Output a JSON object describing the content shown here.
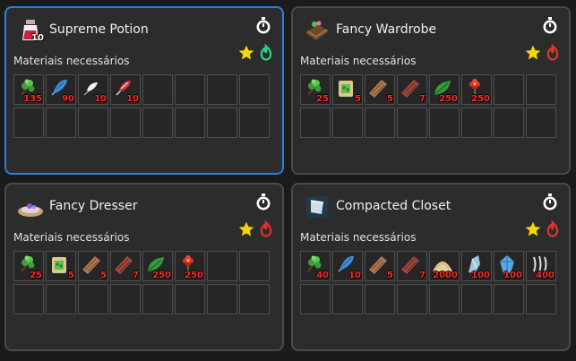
{
  "colors": {
    "selected_border": "#2b7fe0",
    "card_bg": "#2c2c2c",
    "quantity": "#ff2a2a",
    "star": "#f5d50a",
    "flame_red": "#e2332a",
    "flame_green": "#2bd38a"
  },
  "cards": [
    {
      "title": "Supreme Potion",
      "subtitle": "Materiais necessários",
      "icon": "potion-icon",
      "icon_badge": "10",
      "flame": "green",
      "selected": true,
      "materials": [
        {
          "icon": "herb-icon",
          "qty": "135"
        },
        {
          "icon": "blue-feather-icon",
          "qty": "90"
        },
        {
          "icon": "white-feather-icon",
          "qty": "10"
        },
        {
          "icon": "red-feather-icon",
          "qty": "10"
        }
      ]
    },
    {
      "title": "Fancy Wardrobe",
      "subtitle": "Materiais necessários",
      "icon": "wardrobe-icon",
      "flame": "red",
      "selected": false,
      "materials": [
        {
          "icon": "herb-icon",
          "qty": "25"
        },
        {
          "icon": "seed-bag-icon",
          "qty": "5"
        },
        {
          "icon": "wood-plank-icon",
          "qty": "5"
        },
        {
          "icon": "red-wood-plank-icon",
          "qty": "7"
        },
        {
          "icon": "leaf-icon",
          "qty": "250"
        },
        {
          "icon": "red-flower-icon",
          "qty": "250"
        }
      ]
    },
    {
      "title": "Fancy Dresser",
      "subtitle": "Materiais necessários",
      "icon": "dresser-icon",
      "flame": "red",
      "selected": false,
      "materials": [
        {
          "icon": "herb-icon",
          "qty": "25"
        },
        {
          "icon": "seed-bag-icon",
          "qty": "5"
        },
        {
          "icon": "wood-plank-icon",
          "qty": "5"
        },
        {
          "icon": "red-wood-plank-icon",
          "qty": "7"
        },
        {
          "icon": "leaf-icon",
          "qty": "250"
        },
        {
          "icon": "red-flower-icon",
          "qty": "250"
        }
      ]
    },
    {
      "title": "Compacted Closet",
      "subtitle": "Materiais necessários",
      "icon": "closet-icon",
      "flame": "red",
      "selected": false,
      "materials": [
        {
          "icon": "herb-icon",
          "qty": "40"
        },
        {
          "icon": "blue-feather-icon",
          "qty": "10"
        },
        {
          "icon": "wood-plank-icon",
          "qty": "5"
        },
        {
          "icon": "red-wood-plank-icon",
          "qty": "7"
        },
        {
          "icon": "sand-pile-icon",
          "qty": "2000"
        },
        {
          "icon": "ice-shard-icon",
          "qty": "100"
        },
        {
          "icon": "crystal-icon",
          "qty": "100"
        },
        {
          "icon": "claws-icon",
          "qty": "400"
        }
      ]
    }
  ]
}
